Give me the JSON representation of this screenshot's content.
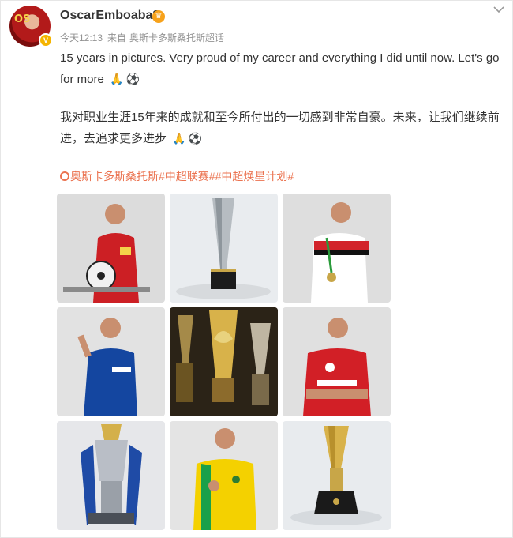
{
  "post": {
    "username": "OscarEmboaba8",
    "avatar_text": "OS",
    "meta": {
      "time": "今天12:13",
      "source_prefix": "来自",
      "source": "奥斯卡多斯桑托斯超话"
    },
    "text_en": "15 years in pictures. Very proud of my career and everything I did until now. Let's go for more",
    "text_cn": "我对职业生涯15年来的成就和至今所付出的一切感到非常自豪。未来，让我们继续前进，去追求更多进步",
    "tags": "奥斯卡多斯桑托斯#中超联赛##中超焕星计划#",
    "icons": [
      "pray-icon",
      "soccer-ball-icon",
      "location-icon",
      "chevron-down-icon",
      "verified-badge-icon",
      "crown-icon"
    ]
  },
  "photos": [
    {
      "name": "photo-shanghai-sipg"
    },
    {
      "name": "photo-silver-trophy"
    },
    {
      "name": "photo-sao-paulo"
    },
    {
      "name": "photo-chelsea"
    },
    {
      "name": "photo-gold-trophies"
    },
    {
      "name": "photo-internacional"
    },
    {
      "name": "photo-premier-league-trophy"
    },
    {
      "name": "photo-brazil"
    },
    {
      "name": "photo-confederations-cup-trophy"
    }
  ]
}
